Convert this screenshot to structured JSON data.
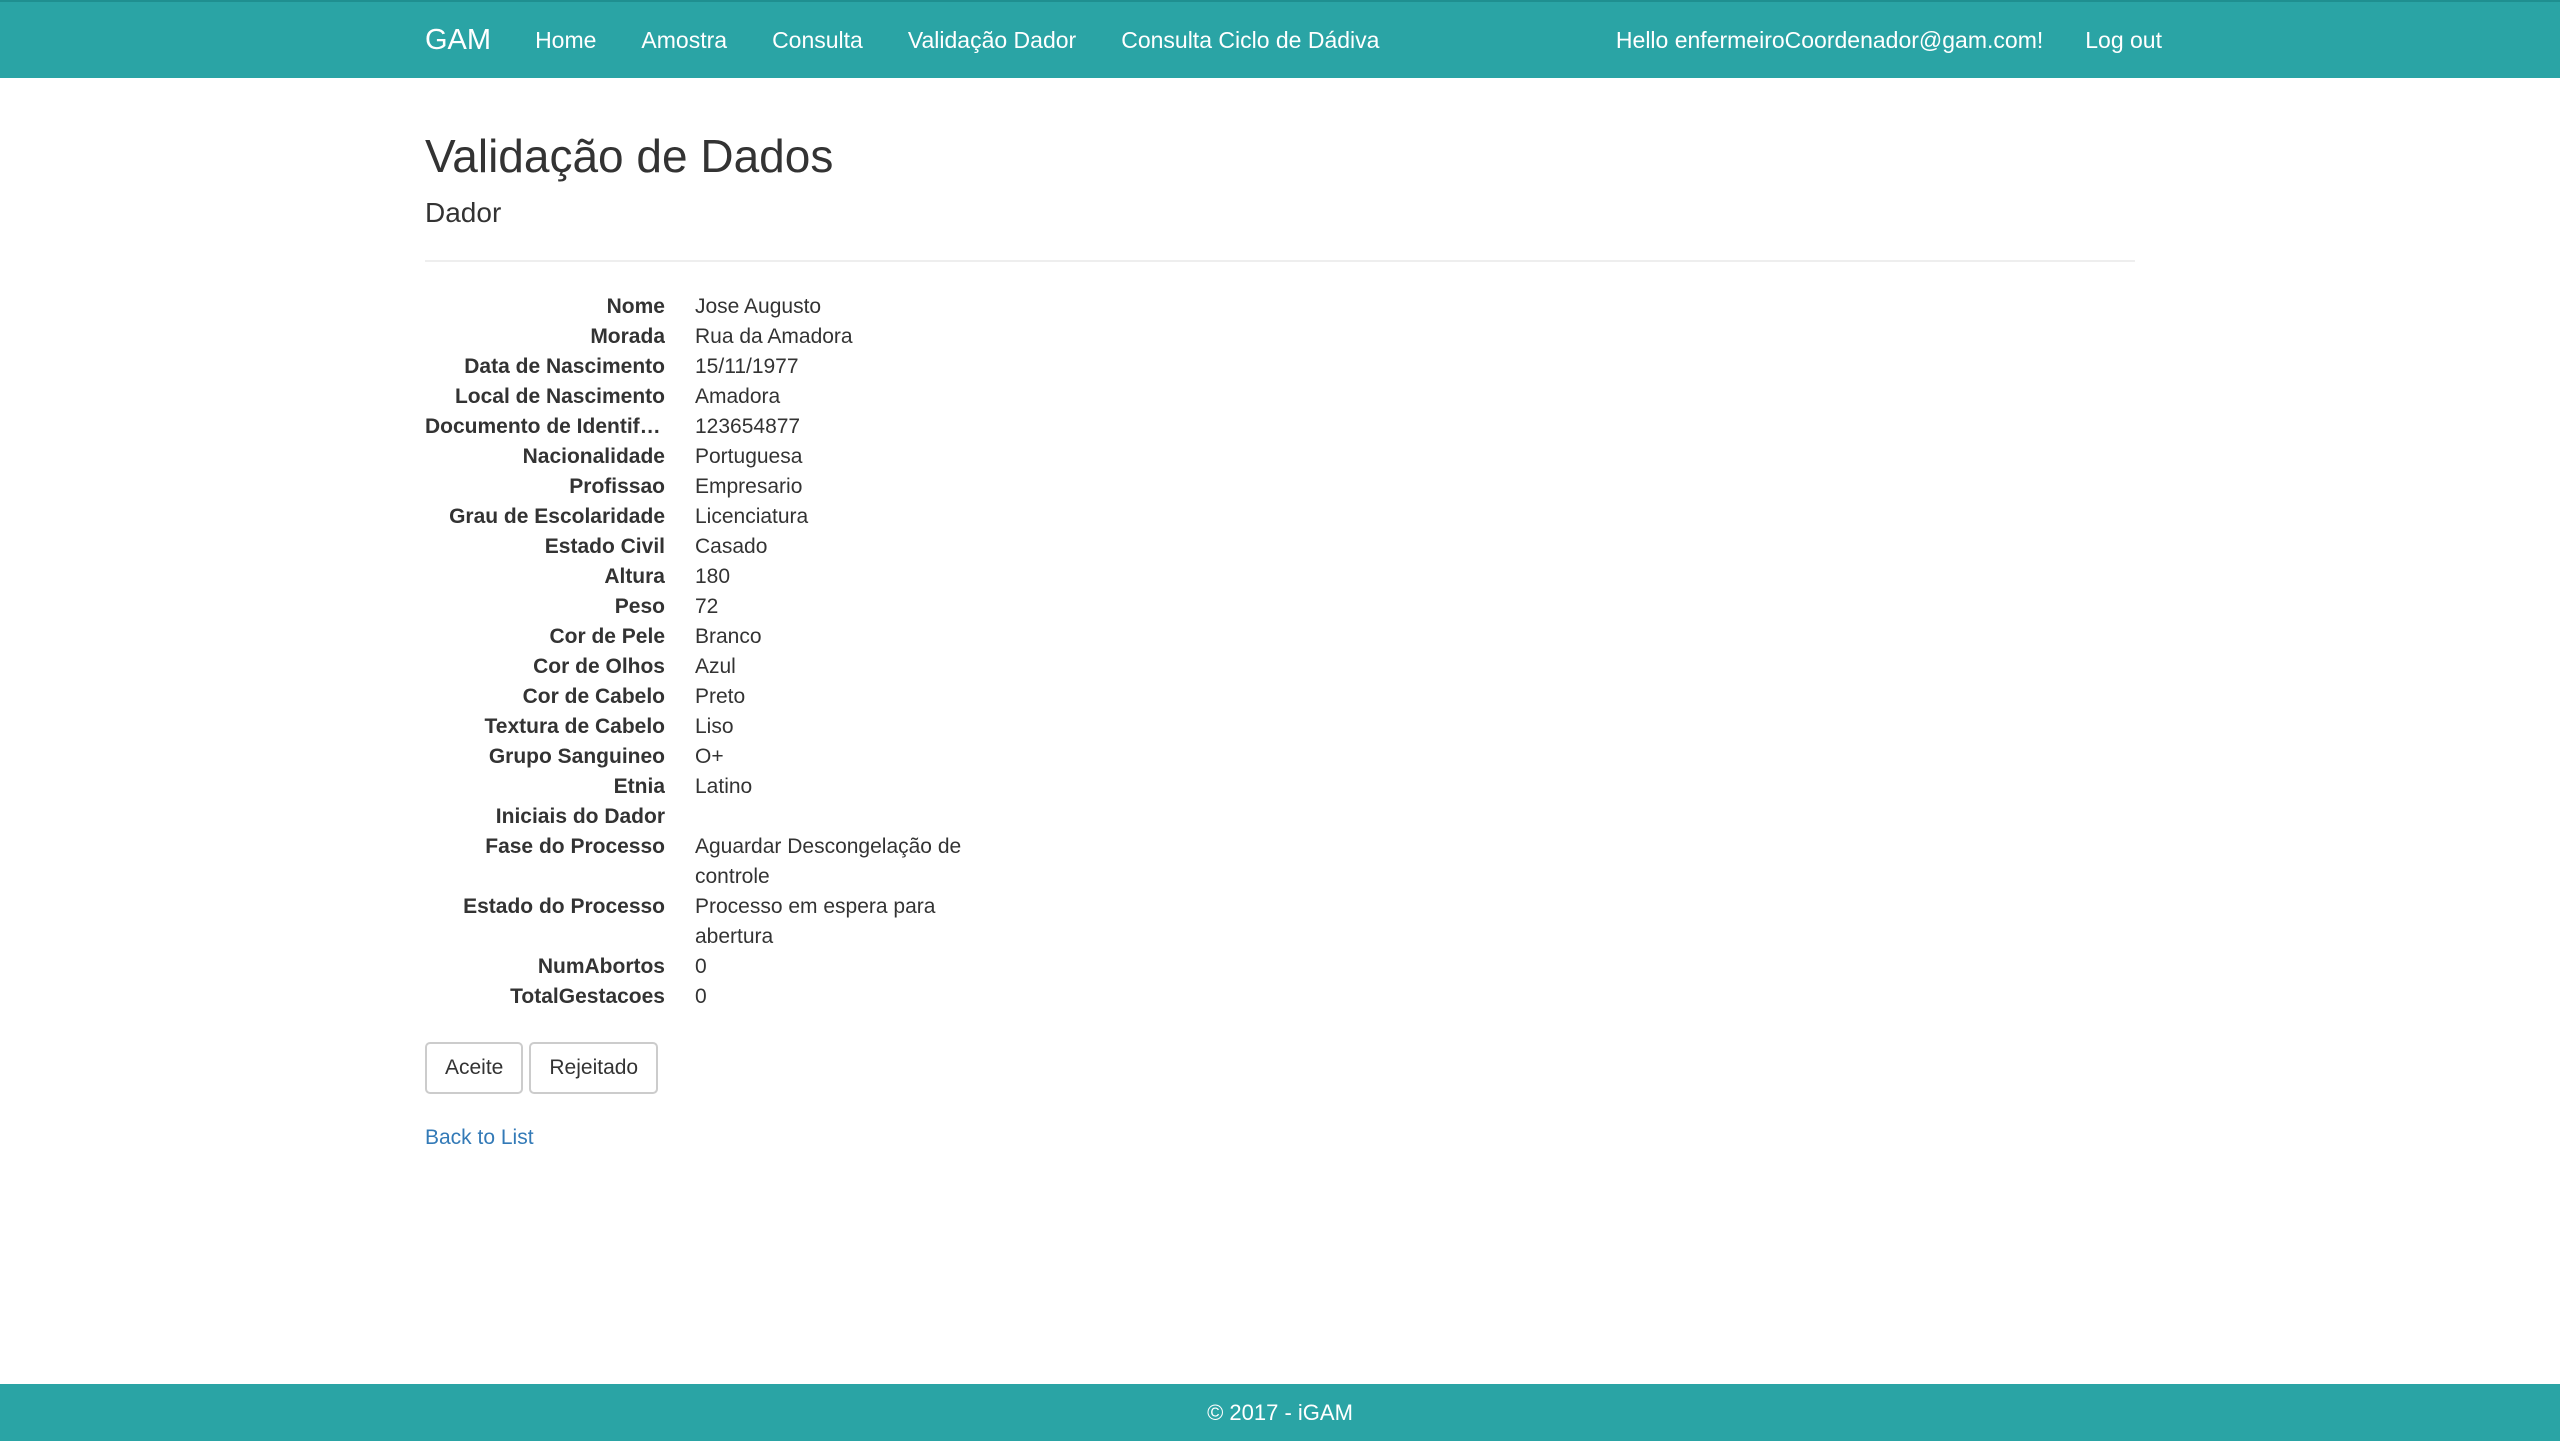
{
  "nav": {
    "brand": "GAM",
    "links": [
      "Home",
      "Amostra",
      "Consulta",
      "Validação Dador",
      "Consulta Ciclo de Dádiva"
    ],
    "greeting": "Hello enfermeiroCoordenador@gam.com!",
    "logout": "Log out"
  },
  "page": {
    "title": "Validação de Dados",
    "subtitle": "Dador"
  },
  "details": [
    {
      "label": "Nome",
      "value": "Jose Augusto"
    },
    {
      "label": "Morada",
      "value": "Rua da Amadora"
    },
    {
      "label": "Data de Nascimento",
      "value": "15/11/1977"
    },
    {
      "label": "Local de Nascimento",
      "value": "Amadora"
    },
    {
      "label": "Documento de Identificação",
      "value": "123654877"
    },
    {
      "label": "Nacionalidade",
      "value": "Portuguesa"
    },
    {
      "label": "Profissao",
      "value": "Empresario"
    },
    {
      "label": "Grau de Escolaridade",
      "value": "Licenciatura"
    },
    {
      "label": "Estado Civil",
      "value": "Casado"
    },
    {
      "label": "Altura",
      "value": "180"
    },
    {
      "label": "Peso",
      "value": "72"
    },
    {
      "label": "Cor de Pele",
      "value": "Branco"
    },
    {
      "label": "Cor de Olhos",
      "value": "Azul"
    },
    {
      "label": "Cor de Cabelo",
      "value": "Preto"
    },
    {
      "label": "Textura de Cabelo",
      "value": "Liso"
    },
    {
      "label": "Grupo Sanguineo",
      "value": "O+"
    },
    {
      "label": "Etnia",
      "value": "Latino"
    },
    {
      "label": "Iniciais do Dador",
      "value": ""
    },
    {
      "label": "Fase do Processo",
      "value": "Aguardar Descongelação de controle"
    },
    {
      "label": "Estado do Processo",
      "value": "Processo em espera para abertura"
    },
    {
      "label": "NumAbortos",
      "value": "0"
    },
    {
      "label": "TotalGestacoes",
      "value": "0"
    }
  ],
  "actions": {
    "accept": "Aceite",
    "reject": "Rejeitado",
    "back": "Back to List"
  },
  "footer": {
    "text": "© 2017 - iGAM"
  },
  "colors": {
    "navbar": "#2aa4a5",
    "link": "#337ab7"
  }
}
